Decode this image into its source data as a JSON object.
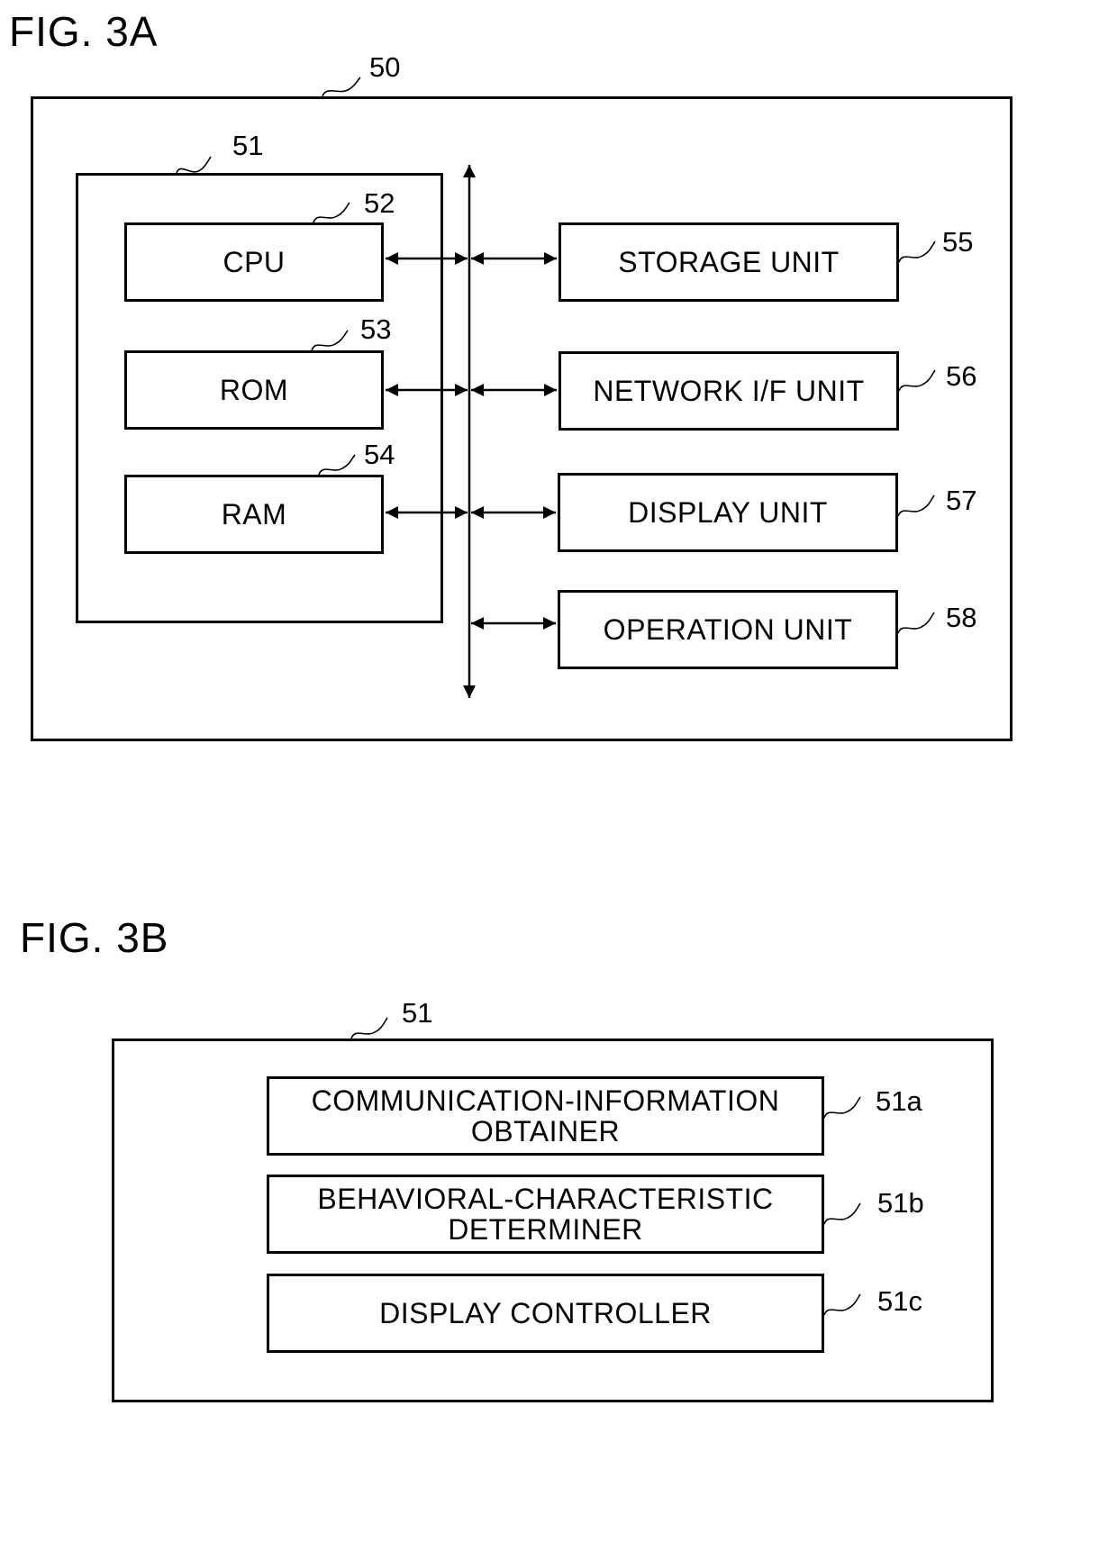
{
  "fig_3a": {
    "title": "FIG. 3A",
    "device": {
      "ref": "50"
    },
    "controller": {
      "ref": "51"
    },
    "internal_units": [
      {
        "id": "cpu",
        "label": "CPU",
        "ref": "52"
      },
      {
        "id": "rom",
        "label": "ROM",
        "ref": "53"
      },
      {
        "id": "ram",
        "label": "RAM",
        "ref": "54"
      }
    ],
    "external_units": [
      {
        "id": "storage",
        "label": "STORAGE UNIT",
        "ref": "55"
      },
      {
        "id": "network",
        "label": "NETWORK I/F UNIT",
        "ref": "56"
      },
      {
        "id": "display",
        "label": "DISPLAY UNIT",
        "ref": "57"
      },
      {
        "id": "operation",
        "label": "OPERATION UNIT",
        "ref": "58"
      }
    ]
  },
  "fig_3b": {
    "title": "FIG. 3B",
    "controller": {
      "ref": "51"
    },
    "units": [
      {
        "id": "obtainer",
        "label": "COMMUNICATION-INFORMATION\nOBTAINER",
        "ref": "51a"
      },
      {
        "id": "determiner",
        "label": "BEHAVIORAL-CHARACTERISTIC\nDETERMINER",
        "ref": "51b"
      },
      {
        "id": "display_controller",
        "label": "DISPLAY CONTROLLER",
        "ref": "51c"
      }
    ]
  }
}
